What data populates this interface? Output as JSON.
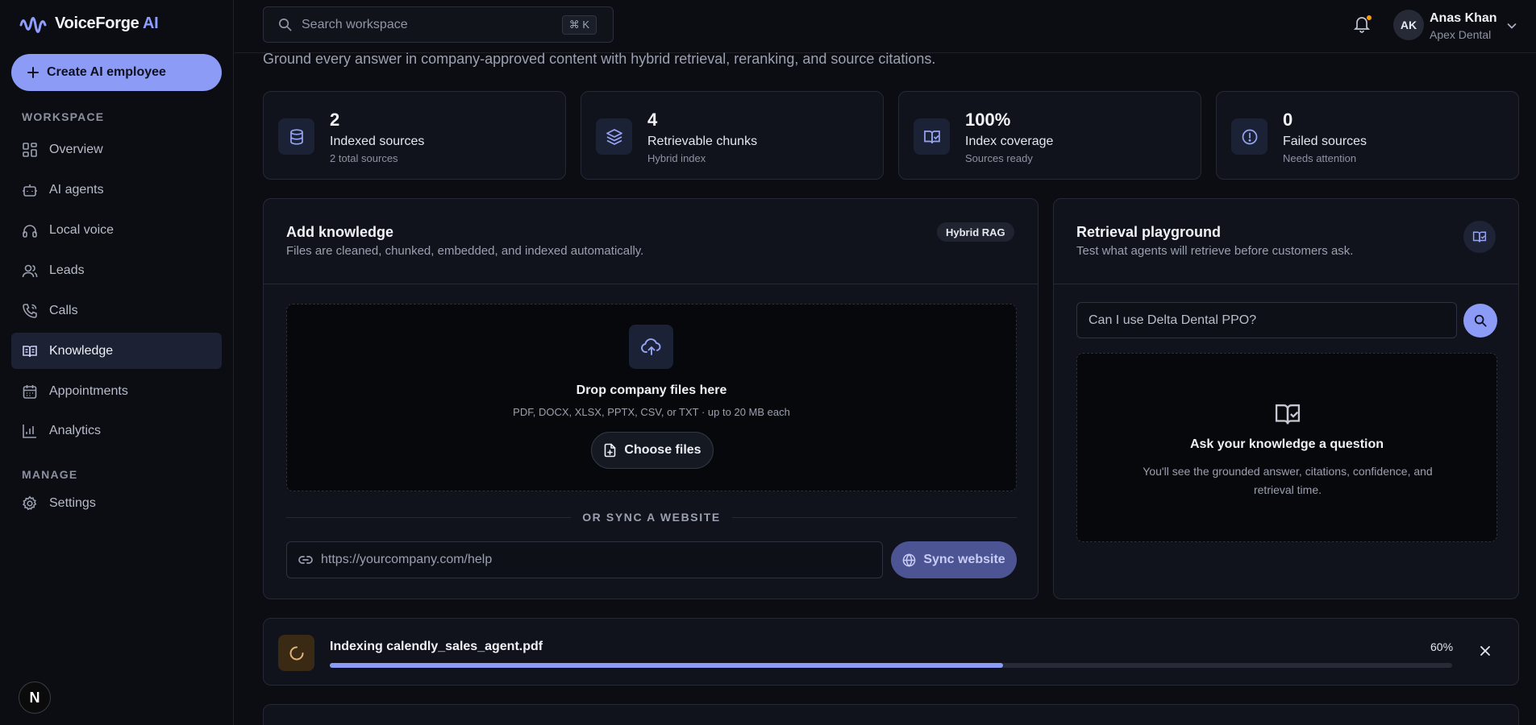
{
  "brand": {
    "name": "VoiceForge",
    "suffix": "AI"
  },
  "sidebar": {
    "create_label": "Create AI employee",
    "sections": [
      {
        "label": "WORKSPACE"
      },
      {
        "label": "MANAGE"
      }
    ],
    "items": [
      {
        "label": "Overview",
        "icon": "grid-icon"
      },
      {
        "label": "AI agents",
        "icon": "bot-icon"
      },
      {
        "label": "Local voice",
        "icon": "headphones-icon"
      },
      {
        "label": "Leads",
        "icon": "users-icon"
      },
      {
        "label": "Calls",
        "icon": "phone-icon"
      },
      {
        "label": "Knowledge",
        "icon": "book-icon",
        "active": true
      },
      {
        "label": "Appointments",
        "icon": "calendar-icon"
      },
      {
        "label": "Analytics",
        "icon": "bar-chart-icon"
      },
      {
        "label": "Settings",
        "icon": "gear-icon"
      }
    ],
    "footer_logo": "N"
  },
  "header": {
    "search_placeholder": "Search workspace",
    "shortcut": "⌘ K",
    "user": {
      "initials": "AK",
      "name": "Anas Khan",
      "org": "Apex Dental"
    }
  },
  "page": {
    "subtitle": "Ground every answer in company-approved content with hybrid retrieval, reranking, and source citations."
  },
  "stats": [
    {
      "value": "2",
      "label": "Indexed sources",
      "sub": "2 total sources",
      "icon": "database-icon"
    },
    {
      "value": "4",
      "label": "Retrievable chunks",
      "sub": "Hybrid index",
      "icon": "layers-icon"
    },
    {
      "value": "100%",
      "label": "Index coverage",
      "sub": "Sources ready",
      "icon": "book-check-icon"
    },
    {
      "value": "0",
      "label": "Failed sources",
      "sub": "Needs attention",
      "icon": "alert-circle-icon"
    }
  ],
  "add_knowledge": {
    "title": "Add knowledge",
    "desc": "Files are cleaned, chunked, embedded, and indexed automatically.",
    "badge": "Hybrid RAG",
    "drop_title": "Drop company files here",
    "drop_hint": "PDF, DOCX, XLSX, PPTX, CSV, or TXT · up to 20 MB each",
    "choose_label": "Choose files",
    "or_sync": "OR SYNC A WEBSITE",
    "url_placeholder": "https://yourcompany.com/help",
    "sync_label": "Sync website"
  },
  "playground": {
    "title": "Retrieval playground",
    "desc": "Test what agents will retrieve before customers ask.",
    "query_value": "Can I use Delta Dental PPO?",
    "empty_title": "Ask your knowledge a question",
    "empty_desc": "You'll see the grounded answer, citations, confidence, and retrieval time."
  },
  "indexing": {
    "title": "Indexing calendly_sales_agent.pdf",
    "percent_label": "60%",
    "progress": 0.6
  },
  "colors": {
    "accent": "#8c9bf5",
    "background": "#0b0d13",
    "card": "#10131b",
    "warning_dot": "#f59e0b"
  }
}
